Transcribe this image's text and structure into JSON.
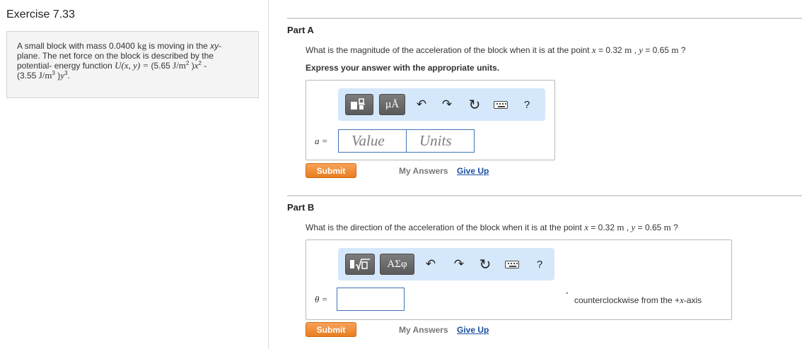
{
  "exercise": {
    "title": "Exercise 7.33"
  },
  "problem": {
    "t1": "A small block with mass 0.0400 ",
    "kg": "kg",
    "t2": " is moving in the ",
    "xy": "xy",
    "t3": "-",
    "t4": "plane. The net force on the block is described by the",
    "t5": "potential- energy function ",
    "U": "U(x, y) = ",
    "t6": "(5.65 ",
    "J1": "J/m",
    "sq": "2",
    "t7": " )",
    "x": "x",
    "sq2": "2",
    "t8": " -",
    "t9": "(3.55 ",
    "J2": "J/m",
    "cu": "3",
    "t10": " )",
    "y": "y",
    "cu2": "3",
    "t11": "."
  },
  "partA": {
    "title": "Part A",
    "q1": "What is the magnitude of the acceleration of the block when it is at the point ",
    "x": "x",
    "eq1": " = 0.32 ",
    "m1": "m",
    "sep": " , ",
    "y": "y",
    "eq2": " = 0.65 ",
    "m2": "m",
    "q2": " ?",
    "instruction": "Express your answer with the appropriate units.",
    "toolbar": {
      "btn1_label": "µÅ",
      "undo": "↶",
      "redo": "↷",
      "reset": "↻",
      "help": "?"
    },
    "var_label": "a =",
    "value_placeholder": "Value",
    "units_placeholder": "Units",
    "submit_label": "Submit",
    "my_answers_label": "My Answers",
    "give_up_label": "Give Up"
  },
  "partB": {
    "title": "Part B",
    "q1": "What is the direction of the acceleration of the block when it is at the point ",
    "x": "x",
    "eq1": " = 0.32 ",
    "m1": "m",
    "sep": " , ",
    "y": "y",
    "eq2": " = 0.65 ",
    "m2": "m",
    "q2": " ?",
    "toolbar": {
      "btn2_label": "ΑΣφ",
      "undo": "↶",
      "redo": "↷",
      "reset": "↻",
      "help": "?"
    },
    "var_label": "θ =",
    "unit_suffix": "counterclockwise from the +",
    "unit_axis": "x",
    "unit_tail": "-axis",
    "degree": "°",
    "submit_label": "Submit",
    "my_answers_label": "My Answers",
    "give_up_label": "Give Up"
  },
  "colors": {
    "toolbar_bg": "#d5e7fb",
    "submit": "#f08a33",
    "link": "#1b4fa3",
    "field_border": "#3f74b5"
  }
}
